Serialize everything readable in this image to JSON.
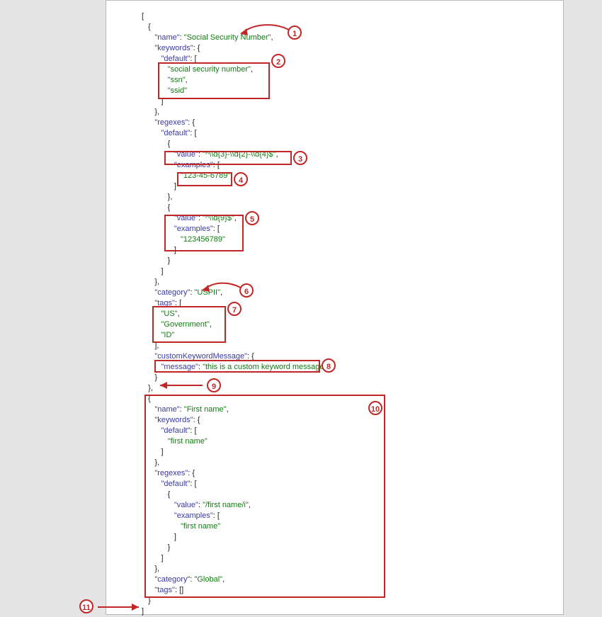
{
  "lines": [
    {
      "indent": 0,
      "label": "",
      "value": "["
    },
    {
      "indent": 1,
      "label": "",
      "value": "{"
    },
    {
      "indent": 2,
      "label": "\"name\"",
      "sep": ": ",
      "str": "\"Social Security Number\"",
      "tail": ","
    },
    {
      "indent": 2,
      "label": "\"keywords\"",
      "sep": ": {",
      "str": ""
    },
    {
      "indent": 3,
      "label": "\"default\"",
      "sep": ": [",
      "str": ""
    },
    {
      "indent": 4,
      "label": "",
      "str": "\"social security number\"",
      "tail": ","
    },
    {
      "indent": 4,
      "label": "",
      "str": "\"ssn\"",
      "tail": ","
    },
    {
      "indent": 4,
      "label": "",
      "str": "\"ssid\""
    },
    {
      "indent": 3,
      "label": "",
      "value": "]"
    },
    {
      "indent": 2,
      "label": "",
      "value": "},"
    },
    {
      "indent": 2,
      "label": "\"regexes\"",
      "sep": ": {",
      "str": ""
    },
    {
      "indent": 3,
      "label": "\"default\"",
      "sep": ": [",
      "str": ""
    },
    {
      "indent": 4,
      "label": "",
      "value": "{"
    },
    {
      "indent": 5,
      "label": "\"value\"",
      "sep": ": ",
      "str": "\"^\\\\d{3}-\\\\d{2}-\\\\d{4}$\"",
      "tail": ","
    },
    {
      "indent": 5,
      "label": "\"examples\"",
      "sep": ": [",
      "str": ""
    },
    {
      "indent": 6,
      "label": "",
      "str": "\"123-45-6789\""
    },
    {
      "indent": 5,
      "label": "",
      "value": "]"
    },
    {
      "indent": 4,
      "label": "",
      "value": "},"
    },
    {
      "indent": 4,
      "label": "",
      "value": "{"
    },
    {
      "indent": 5,
      "label": "\"value\"",
      "sep": ": ",
      "str": "\"^\\\\d{9}$\"",
      "tail": ","
    },
    {
      "indent": 5,
      "label": "\"examples\"",
      "sep": ": [",
      "str": ""
    },
    {
      "indent": 6,
      "label": "",
      "str": "\"123456789\""
    },
    {
      "indent": 5,
      "label": "",
      "value": "]"
    },
    {
      "indent": 4,
      "label": "",
      "value": "}"
    },
    {
      "indent": 3,
      "label": "",
      "value": "]"
    },
    {
      "indent": 2,
      "label": "",
      "value": "},"
    },
    {
      "indent": 2,
      "label": "\"category\"",
      "sep": ": ",
      "str": "\"USPII\"",
      "tail": ","
    },
    {
      "indent": 2,
      "label": "\"tags\"",
      "sep": ": [",
      "str": ""
    },
    {
      "indent": 3,
      "label": "",
      "str": "\"US\"",
      "tail": ","
    },
    {
      "indent": 3,
      "label": "",
      "str": "\"Government\"",
      "tail": ","
    },
    {
      "indent": 3,
      "label": "",
      "str": "\"ID\""
    },
    {
      "indent": 2,
      "label": "",
      "value": "],"
    },
    {
      "indent": 2,
      "label": "\"customKeywordMessage\"",
      "sep": ": {",
      "str": ""
    },
    {
      "indent": 3,
      "label": "\"message\"",
      "sep": ": ",
      "str": "\"this is a custom keyword message\""
    },
    {
      "indent": 2,
      "label": "",
      "value": "}"
    },
    {
      "indent": 1,
      "label": "",
      "value": "},"
    },
    {
      "indent": 1,
      "label": "",
      "value": "{"
    },
    {
      "indent": 2,
      "label": "\"name\"",
      "sep": ": ",
      "str": "\"First name\"",
      "tail": ","
    },
    {
      "indent": 2,
      "label": "\"keywords\"",
      "sep": ": {",
      "str": ""
    },
    {
      "indent": 3,
      "label": "\"default\"",
      "sep": ": [",
      "str": ""
    },
    {
      "indent": 4,
      "label": "",
      "str": "\"first name\""
    },
    {
      "indent": 3,
      "label": "",
      "value": "]"
    },
    {
      "indent": 2,
      "label": "",
      "value": "},"
    },
    {
      "indent": 2,
      "label": "\"regexes\"",
      "sep": ": {",
      "str": ""
    },
    {
      "indent": 3,
      "label": "\"default\"",
      "sep": ": [",
      "str": ""
    },
    {
      "indent": 4,
      "label": "",
      "value": "{"
    },
    {
      "indent": 5,
      "label": "\"value\"",
      "sep": ": ",
      "str": "\"/first name/i\"",
      "tail": ","
    },
    {
      "indent": 5,
      "label": "\"examples\"",
      "sep": ": [",
      "str": ""
    },
    {
      "indent": 6,
      "label": "",
      "str": "\"first name\""
    },
    {
      "indent": 5,
      "label": "",
      "value": "]"
    },
    {
      "indent": 4,
      "label": "",
      "value": "}"
    },
    {
      "indent": 3,
      "label": "",
      "value": "]"
    },
    {
      "indent": 2,
      "label": "",
      "value": "},"
    },
    {
      "indent": 2,
      "label": "\"category\"",
      "sep": ": ",
      "str": "\"Global\"",
      "tail": ","
    },
    {
      "indent": 2,
      "label": "\"tags\"",
      "sep": ": []",
      "str": ""
    },
    {
      "indent": 1,
      "label": "",
      "value": "}"
    },
    {
      "indent": 0,
      "label": "",
      "value": "]"
    }
  ],
  "callouts": {
    "n1": "1",
    "n2": "2",
    "n3": "3",
    "n4": "4",
    "n5": "5",
    "n6": "6",
    "n7": "7",
    "n8": "8",
    "n9": "9",
    "n10": "10",
    "n11": "11"
  }
}
